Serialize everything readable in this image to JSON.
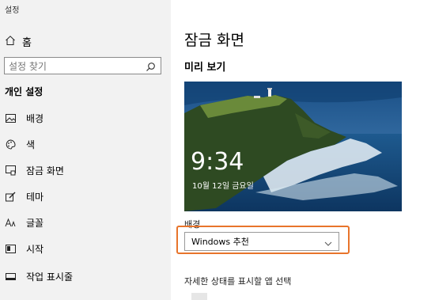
{
  "app": {
    "title": "설정"
  },
  "sidebar": {
    "home_label": "홈",
    "search_placeholder": "설정 찾기",
    "section_title": "개인 설정",
    "items": [
      {
        "label": "배경",
        "icon": "image-icon"
      },
      {
        "label": "색",
        "icon": "palette-icon"
      },
      {
        "label": "잠금 화면",
        "icon": "lock-screen-icon"
      },
      {
        "label": "테마",
        "icon": "theme-brush-icon"
      },
      {
        "label": "글꼴",
        "icon": "font-icon"
      },
      {
        "label": "시작",
        "icon": "start-icon"
      },
      {
        "label": "작업 표시줄",
        "icon": "taskbar-icon"
      }
    ]
  },
  "main": {
    "title": "잠금 화면",
    "preview_title": "미리 보기",
    "preview": {
      "time": "9:34",
      "date": "10월 12일 금요일"
    },
    "background_label": "배경",
    "background_value": "Windows 추천",
    "detail_status_label": "자세한 상태를 표시할 앱 선택"
  },
  "colors": {
    "sidebar_bg": "#f2f2f2",
    "highlight": "#e8742b"
  }
}
